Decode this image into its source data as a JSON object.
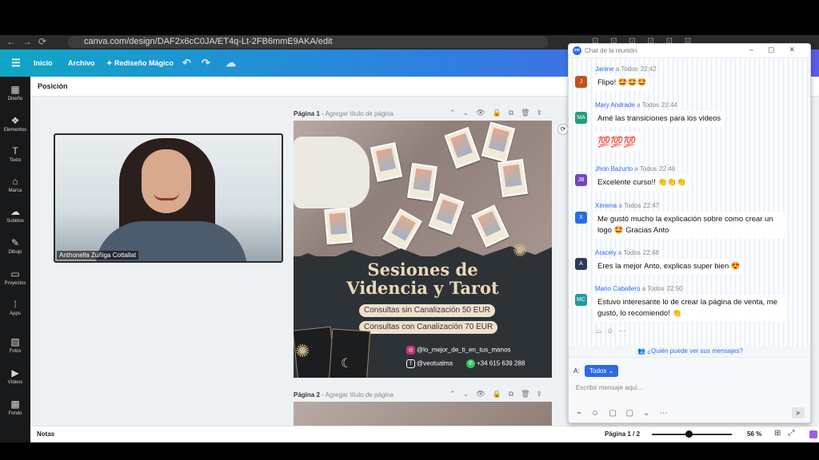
{
  "browser": {
    "url": "canva.com/design/DAF2x6cC0JA/ET4q-Lt-2FB6mmE9AKA/edit",
    "nav_glyphs": "←→⟳"
  },
  "canva_header": {
    "menu_icon": "☰",
    "items": [
      "Inicio",
      "Archivo",
      "Rediseño Mágico"
    ],
    "magic_glyph": "✦",
    "undo": "↶",
    "redo": "↷",
    "cloud": "☁"
  },
  "sidebar": {
    "items": [
      {
        "label": "Diseño",
        "icon": "▦"
      },
      {
        "label": "Elementos",
        "icon": "❖"
      },
      {
        "label": "Texto",
        "icon": "T"
      },
      {
        "label": "Marca",
        "icon": "⌂"
      },
      {
        "label": "Subidos",
        "icon": "☁"
      },
      {
        "label": "Dibujo",
        "icon": "✎"
      },
      {
        "label": "Proyectos",
        "icon": "▭"
      },
      {
        "label": "Apps",
        "icon": "⁞"
      },
      {
        "label": "Fotos",
        "icon": "▨"
      },
      {
        "label": "Vídeos",
        "icon": "▶"
      },
      {
        "label": "Fondo",
        "icon": "▩"
      }
    ]
  },
  "toolbar": {
    "position_label": "Posición"
  },
  "video": {
    "participant_name": "Anthonella Zuñiga Cottallat"
  },
  "pages": [
    {
      "title": "Página 1",
      "add_title": "Agregar título de página",
      "tools": "⌃⌄👁🔒⧉🗑⇪"
    },
    {
      "title": "Página 2",
      "add_title": "Agregar título de página",
      "tools": "⌃⌄👁🔒⧉🗑⇪"
    }
  ],
  "poster": {
    "title_line1": "Sesiones de",
    "title_line2": "Videncia y Tarot",
    "offer1": "Consultas sin Canalización 50 EUR",
    "offer2": "Consultas con Canalización 70 EUR",
    "instagram": "@lo_mejor_de_ti_en_tus_manos",
    "facebook": "@veotualma",
    "whatsapp": "+34 615 639 288",
    "sun_glyph": "✺",
    "moon_glyph": "☾"
  },
  "bottombar": {
    "notes": "Notas",
    "page_counter": "Página 1 / 2",
    "zoom_percent": 56,
    "zoom": "56 %",
    "icons": "⊞⤢"
  },
  "chat": {
    "title": "Chat de la reunión",
    "window_controls": "–▢✕",
    "messages": [
      {
        "sender": "Janine",
        "to": "a Todos",
        "time": "22:42",
        "text": "Flipo! 🤩🤩🤩",
        "avatar": "J",
        "color": "#c0531f"
      },
      {
        "sender": "Mary Andrade",
        "to": "a Todos",
        "time": "22:44",
        "text": "Amé las transiciones para los videos",
        "text2": "💯💯💯",
        "avatar": "MA",
        "color": "#1fa07a"
      },
      {
        "sender": "Jhon Bazurto",
        "to": "a Todos",
        "time": "22:46",
        "text": "Excelente curso!! 👏👏👏",
        "avatar": "JB",
        "color": "#7046c1"
      },
      {
        "sender": "Ximena",
        "to": "a Todos",
        "time": "22:47",
        "text": "Me gustó mucho la explicación sobre como crear un logo 🤩 Gracias Anto",
        "avatar": "X",
        "color": "#2d6be5"
      },
      {
        "sender": "Aracely",
        "to": "a Todos",
        "time": "22:48",
        "text": "Eres la mejor Anto, explicas super bien 😍",
        "avatar": "A",
        "color": "#2d3a5a"
      },
      {
        "sender": "Mario Caballero",
        "to": "a Todos",
        "time": "22:50",
        "text": "Estuvo interesante lo de crear la página de venta, me gustó, lo recomiendo! 👏",
        "avatar": "MC",
        "color": "#1f9aa0"
      }
    ],
    "msg_actions": "⌓☺⋯",
    "who_can_see": "👥 ¿Quién puede ver sus mensajes?",
    "to_label": "A:",
    "recipient": "Todos ⌄",
    "input_placeholder": "Escribir mensaje aquí...",
    "tool_icons": "⌁☺▢▢⌄⋯",
    "send_glyph": "➤"
  }
}
